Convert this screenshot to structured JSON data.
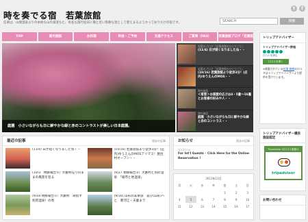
{
  "header": {
    "site_title": "時を奏でる宿　若葉旅館",
    "tagline": "信楽は、山間温泉よりの本格な山の湯溶ちた、有名な旅行宿日に冊と近い等静な温として使えまるようかっておりだけの宿です。",
    "social": [
      {
        "icon": "twitter-icon",
        "label": "t"
      },
      {
        "icon": "facebook-icon",
        "label": "f"
      }
    ],
    "search": {
      "placeholder": "SEARCH",
      "button_label": "検索"
    }
  },
  "nav": {
    "items": [
      "TOP",
      "館内施設",
      "お料理",
      "料金・ご予約",
      "交通アクセス",
      "ご質問（FAQ）",
      "若葉旅館ブログ「若葉館"
    ]
  },
  "hero": {
    "caption": "庭園　小さいながらも日に鮮やかな緑と赤のコントラストが美しい日本庭園。"
  },
  "slides": [
    {
      "category": "若葉のブログ「若葉旅館のひとりごと」",
      "title": "(11/4) 日が短くなりましたね・・",
      "active": true
    },
    {
      "category": "若葉のブログ「若葉旅館のひとりごと」",
      "title": "(10/16) 若葉旅館より徒歩3分！(庄内)ゆうえんのMOS・・",
      "active": false
    },
    {
      "category": "館内施設",
      "title": "＜客室＞お部屋の広さは4・5畳〜16畳とお客様の好みや人・・",
      "active": false
    },
    {
      "category": "館内施設",
      "title": "庭園　小さいながらも日に鮮やかな緑と赤のコントラス・・",
      "active": false
    }
  ],
  "recent": {
    "title": "最近の記事",
    "more": "過去の記事",
    "items": [
      "(11/4) 日が短くなりましたね・・",
      "(10/16) 若葉旅館より徒歩3分！(庄内)ゆうえんのMOSアリマス！屋台村オープン・・",
      "(10/3　視察報告③）大藪村在りのままの風景を巡る",
      "(9/27 視察報告②）大藪村と別府温泉　「樹市と地温泉」",
      "(9/18 視察報告①）大藪村　目指す別府温泉！の巻",
      "(9/16) 山形の美食旅　雲ひ(山形)へと　寒河江・天童まで"
    ]
  },
  "notice": {
    "title": "お知らせ",
    "more": "過去の記事",
    "date": "2013/7/14",
    "text": "For Int'l Guests – Click Here for the Online Reservation !"
  },
  "calendar": {
    "caption": "2013年11月",
    "weekdays": [
      "月",
      "火",
      "水",
      "木",
      "金",
      "土",
      "日"
    ],
    "weeks": [
      [
        "",
        "",
        "",
        "",
        "1",
        "2",
        "3"
      ],
      [
        "4",
        "5",
        "6",
        "7",
        "8",
        "9",
        "10"
      ],
      [
        "11",
        "12",
        "13",
        "14",
        "15",
        "16",
        "17"
      ]
    ],
    "today": "5"
  },
  "sidebar": {
    "tripadvisor": {
      "title": "トリップアドバイザー",
      "rating_label": "トリップアドバイザー評価",
      "review_link": "口コミを読む",
      "write_button": "口コミを書く"
    },
    "reviews_text": "※掲載されている",
    "reviews_link": "若葉 旅館",
    "reviews_text2": "の口コミはトリップアドバイザーより提供を受けています。",
    "ta_link2": "トリップアドバイザー",
    "excellence": {
      "title": "トリップアドバイザー優良施設認定",
      "badge_text": "Tripadvisor の口コミ無数カ",
      "logo_text": "tripadvisor"
    },
    "contact": {
      "title": "お問い合わせ"
    }
  },
  "colors": {
    "nav": "#e88cb6",
    "accent": "#589442"
  }
}
